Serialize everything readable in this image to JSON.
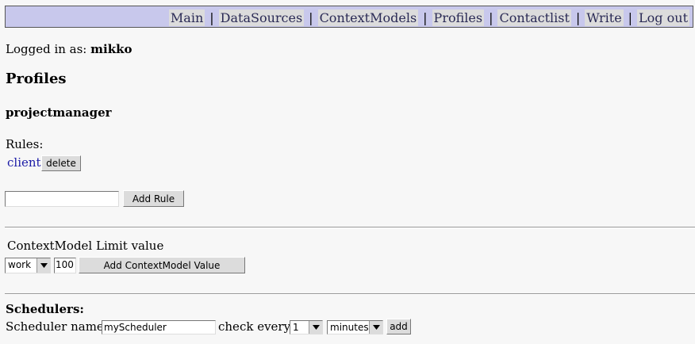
{
  "nav": {
    "items": [
      {
        "label": "Main"
      },
      {
        "label": "DataSources"
      },
      {
        "label": "ContextModels"
      },
      {
        "label": "Profiles"
      },
      {
        "label": "Contactlist"
      },
      {
        "label": "Write"
      },
      {
        "label": "Log out"
      }
    ],
    "separator": "|"
  },
  "login": {
    "prefix": "Logged in as:",
    "username": "mikko"
  },
  "page_title": "Profiles",
  "profile": {
    "name": "projectmanager"
  },
  "rules": {
    "label": "Rules:",
    "items": [
      {
        "name": "client",
        "delete_label": "delete"
      }
    ],
    "new_rule_value": "",
    "add_rule_label": "Add Rule"
  },
  "context_model": {
    "header": "ContextModel Limit value",
    "selected_model": "work",
    "limit_value": "100",
    "add_label": "Add ContextModel Value"
  },
  "schedulers": {
    "title": "Schedulers:",
    "name_label": "Scheduler name:",
    "name_value": "myScheduler",
    "check_every_label": "check every",
    "interval_value": "1",
    "unit_value": "minutes",
    "add_label": "add"
  },
  "colors": {
    "nav_bg": "#c8c8ec",
    "link": "#1a1aa6",
    "page_bg": "#f7f7f7"
  }
}
